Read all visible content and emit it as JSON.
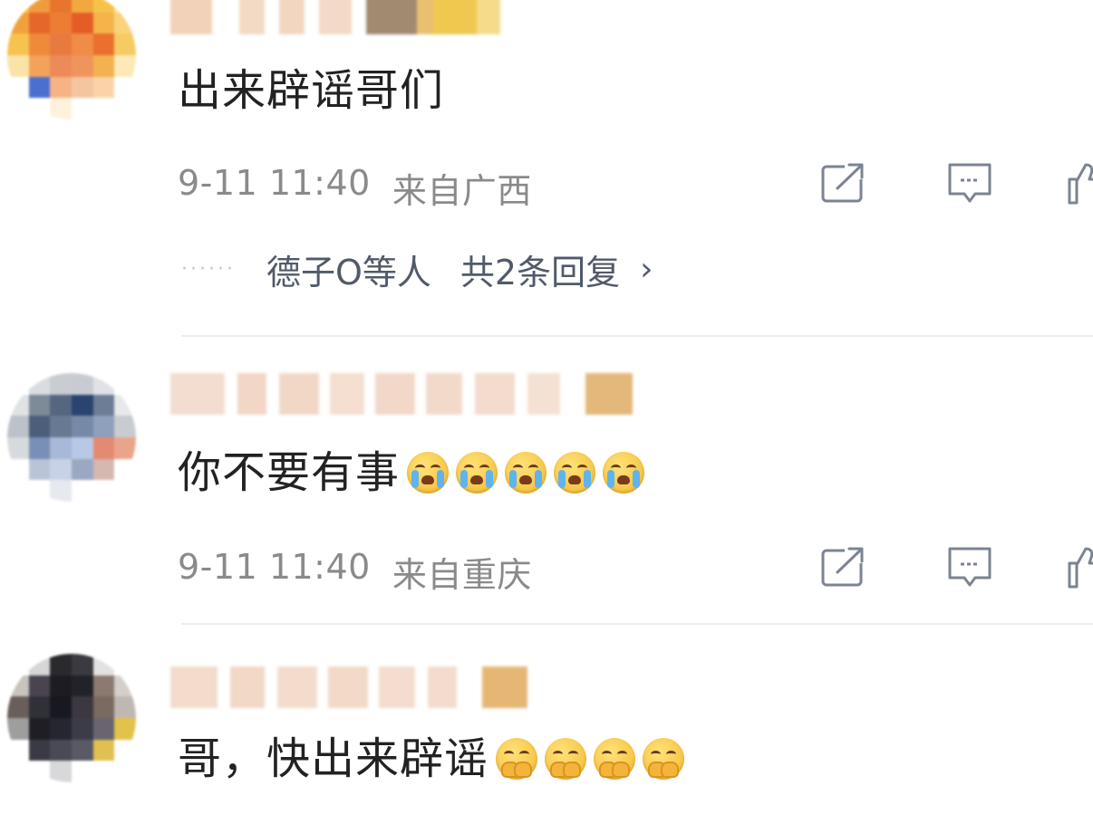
{
  "comments": [
    {
      "text": "出来辟谣哥们",
      "time": "9-11 11:40",
      "location": "来自广西",
      "reply_users": "德子O等人",
      "reply_count": "共2条回复",
      "reply_chevron": "›"
    },
    {
      "text": "你不要有事",
      "emojis": [
        "cry-emoji",
        "cry-emoji",
        "cry-emoji",
        "cry-emoji",
        "cry-emoji"
      ],
      "time": "9-11 11:40",
      "location": "来自重庆"
    },
    {
      "text": "哥，快出来辟谣",
      "emojis": [
        "pleading-emoji",
        "pleading-emoji",
        "pleading-emoji",
        "pleading-emoji"
      ]
    }
  ],
  "icons": [
    "share-icon",
    "comment-icon",
    "like-icon"
  ],
  "colors": {
    "meta_text": "#8a8a8a",
    "reply_text": "#505a6a",
    "icon_stroke": "#7b8491"
  }
}
